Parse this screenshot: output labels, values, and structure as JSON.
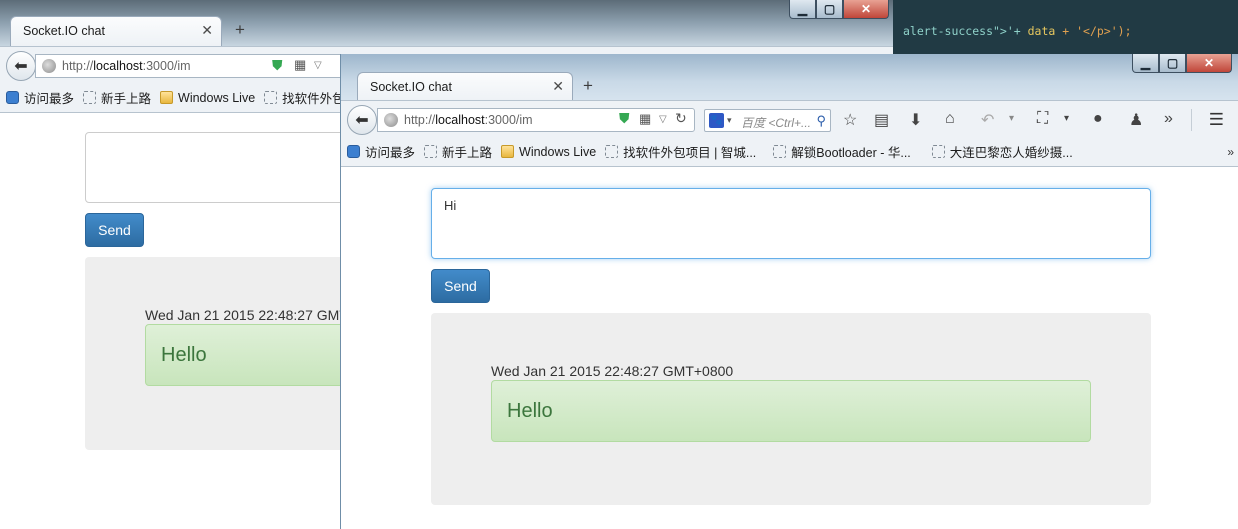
{
  "editor": {
    "code_prefix": "alert-success\">'+ ",
    "code_kw": "data",
    "code_suffix": " + '</p>');"
  },
  "back_window": {
    "tab_title": "Socket.IO chat",
    "url_prefix": "http://",
    "url_host": "localhost",
    "url_path": ":3000/im",
    "bookmarks": [
      "访问最多",
      "新手上路",
      "Windows Live",
      "找软件外包"
    ],
    "message_input_value": "",
    "send_label": "Send",
    "messages": [
      {
        "timestamp": "Wed Jan 21 2015 22:48:27 GMT",
        "text": "Hello"
      }
    ]
  },
  "front_window": {
    "tab_title": "Socket.IO chat",
    "url_prefix": "http://",
    "url_host": "localhost",
    "url_path": ":3000/im",
    "search_placeholder": "百度 <Ctrl+...",
    "bookmarks": [
      "访问最多",
      "新手上路",
      "Windows Live",
      "找软件外包项目 | 智城...",
      "解锁Bootloader - 华...",
      "大连巴黎恋人婚纱摄..."
    ],
    "message_input_value": "Hi",
    "send_label": "Send",
    "messages": [
      {
        "timestamp": "Wed Jan 21 2015 22:48:27 GMT+0800",
        "text": "Hello"
      }
    ]
  },
  "colors": {
    "primary_button": "#428bca",
    "success_bg": "#dff0d8",
    "success_text": "#3c763d",
    "well_bg": "#eeeeee"
  }
}
